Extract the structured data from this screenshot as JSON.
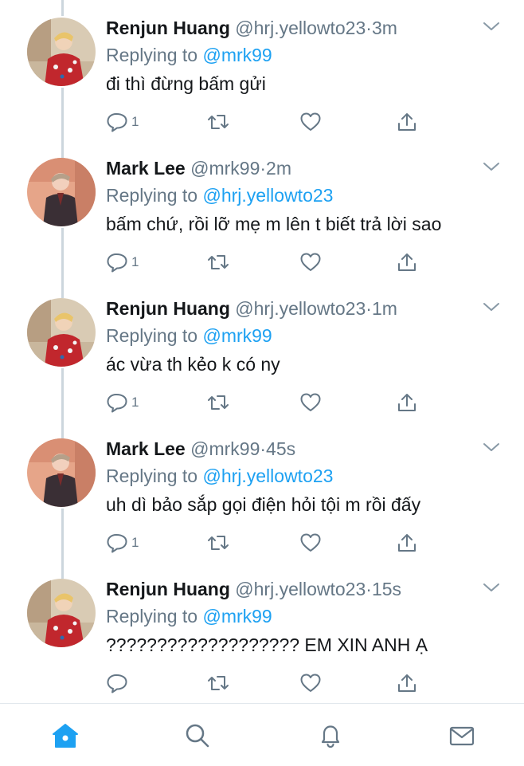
{
  "thread": [
    {
      "author": "Renjun Huang",
      "handle": "@hrj.yellowto23",
      "separator": "·",
      "time": "3m",
      "replying_prefix": "Replying to",
      "replying_to": "@mrk99",
      "text": "đi thì đừng bấm gửi",
      "reply_count": "1"
    },
    {
      "author": "Mark Lee",
      "handle": "@mrk99",
      "separator": "·",
      "time": "2m",
      "replying_prefix": "Replying to",
      "replying_to": "@hrj.yellowto23",
      "text": "bấm chứ, rồi lỡ mẹ m lên t biết trả lời sao",
      "reply_count": "1"
    },
    {
      "author": "Renjun Huang",
      "handle": "@hrj.yellowto23",
      "separator": "·",
      "time": "1m",
      "replying_prefix": "Replying to",
      "replying_to": "@mrk99",
      "text": "ác vừa th kẻo k có ny",
      "reply_count": "1"
    },
    {
      "author": "Mark Lee",
      "handle": "@mrk99",
      "separator": "·",
      "time": "45s",
      "replying_prefix": "Replying to",
      "replying_to": "@hrj.yellowto23",
      "text": "uh dì bảo sắp gọi điện hỏi tội m rồi đấy",
      "reply_count": "1"
    },
    {
      "author": "Renjun Huang",
      "handle": "@hrj.yellowto23",
      "separator": "·",
      "time": "15s",
      "replying_prefix": "Replying to",
      "replying_to": "@mrk99",
      "text": "??????????????????? EM XIN ANH Ạ",
      "reply_count": ""
    }
  ],
  "icons": {
    "reply": "reply-icon",
    "retweet": "retweet-icon",
    "like": "heart-icon",
    "share": "share-icon",
    "more": "chevron-down-icon"
  },
  "tabbar": {
    "items": [
      "home-icon",
      "search-icon",
      "notifications-icon",
      "messages-icon"
    ],
    "active": "home-icon"
  },
  "colors": {
    "accent": "#1da1f2",
    "secondary_text": "#657786",
    "primary_text": "#14171a",
    "thread_line": "#ccd6dd",
    "divider": "#e1e8ed"
  }
}
